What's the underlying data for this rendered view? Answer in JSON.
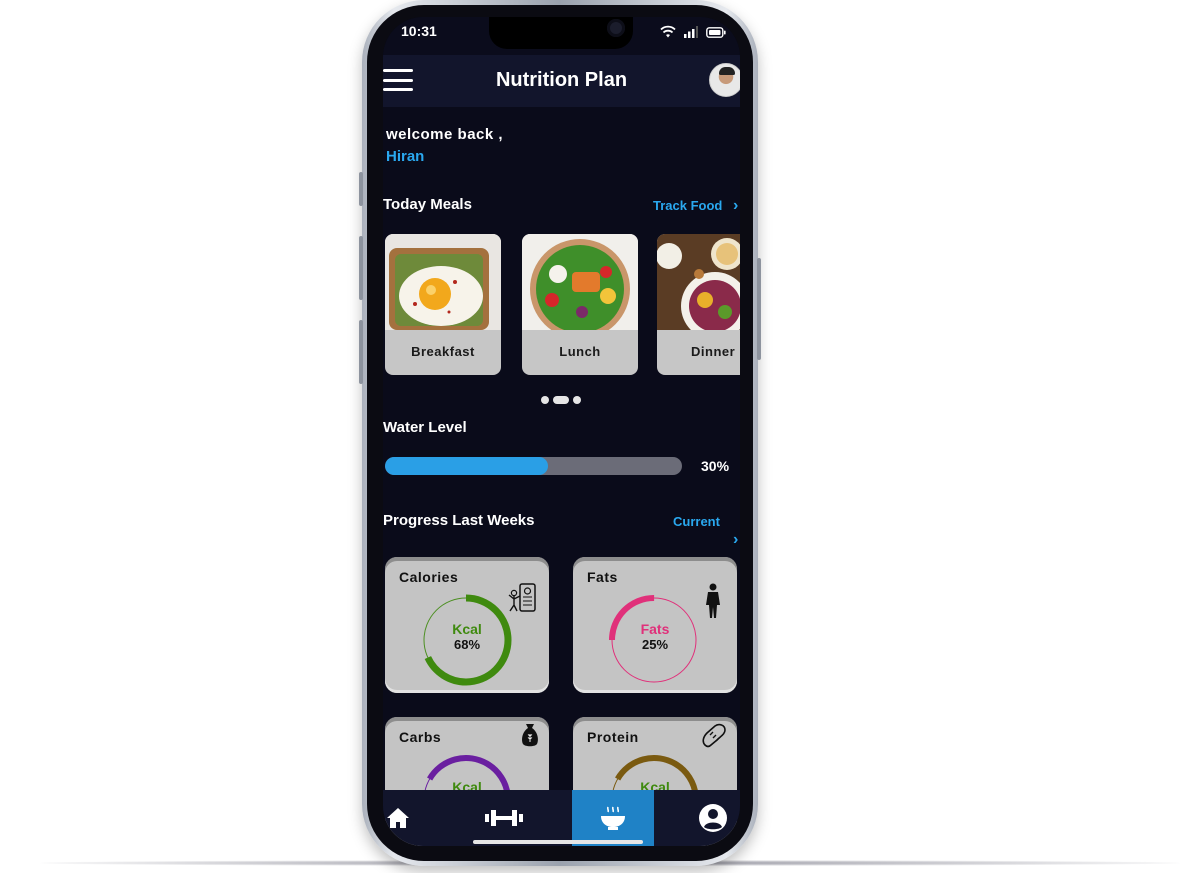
{
  "status_bar": {
    "time": "10:31"
  },
  "app_bar": {
    "title": "Nutrition Plan"
  },
  "greeting": {
    "welcome": "welcome back ,",
    "name": "Hiran"
  },
  "meals_section": {
    "title": "Today Meals",
    "track_link": "Track Food",
    "meals": [
      {
        "label": "Breakfast"
      },
      {
        "label": "Lunch"
      },
      {
        "label": "Dinner"
      }
    ],
    "page_indicator": {
      "pages": 3,
      "active": 1
    }
  },
  "water": {
    "title": "Water Level",
    "percent_text": "30%",
    "fill_fraction": 0.55
  },
  "progress_section": {
    "title": "Progress Last Weeks",
    "current_link": "Current",
    "cards": [
      {
        "title": "Calories",
        "ring_label": "Kcal",
        "ring_value": "68%",
        "ring_fraction": 0.68,
        "color": "#3f8a0f",
        "label_color": "#3f8a0f",
        "icon": "fitness-app-icon"
      },
      {
        "title": "Fats",
        "ring_label": "Fats",
        "ring_value": "25%",
        "ring_fraction": 0.25,
        "color": "#e0307a",
        "label_color": "#e0307a",
        "icon": "body-silhouette-icon"
      },
      {
        "title": "Carbs",
        "ring_label": "Kcal",
        "ring_value": "",
        "ring_fraction": 0.4,
        "color": "#6a1fa0",
        "label_color": "#3f8a0f",
        "icon": "grain-sack-icon"
      },
      {
        "title": "Protein",
        "ring_label": "Kcal",
        "ring_value": "",
        "ring_fraction": 0.4,
        "color": "#7a5a10",
        "label_color": "#3f8a0f",
        "icon": "drumstick-icon"
      }
    ]
  },
  "bottom_nav": {
    "items": [
      {
        "icon": "home-icon",
        "active": false
      },
      {
        "icon": "dumbbell-icon",
        "active": false
      },
      {
        "icon": "food-bowl-icon",
        "active": true
      },
      {
        "icon": "profile-icon",
        "active": false
      }
    ]
  },
  "colors": {
    "accent": "#2aa8ef",
    "background": "#0a0b1a",
    "bar": "#12152c",
    "active_tab": "#1f82c6"
  }
}
